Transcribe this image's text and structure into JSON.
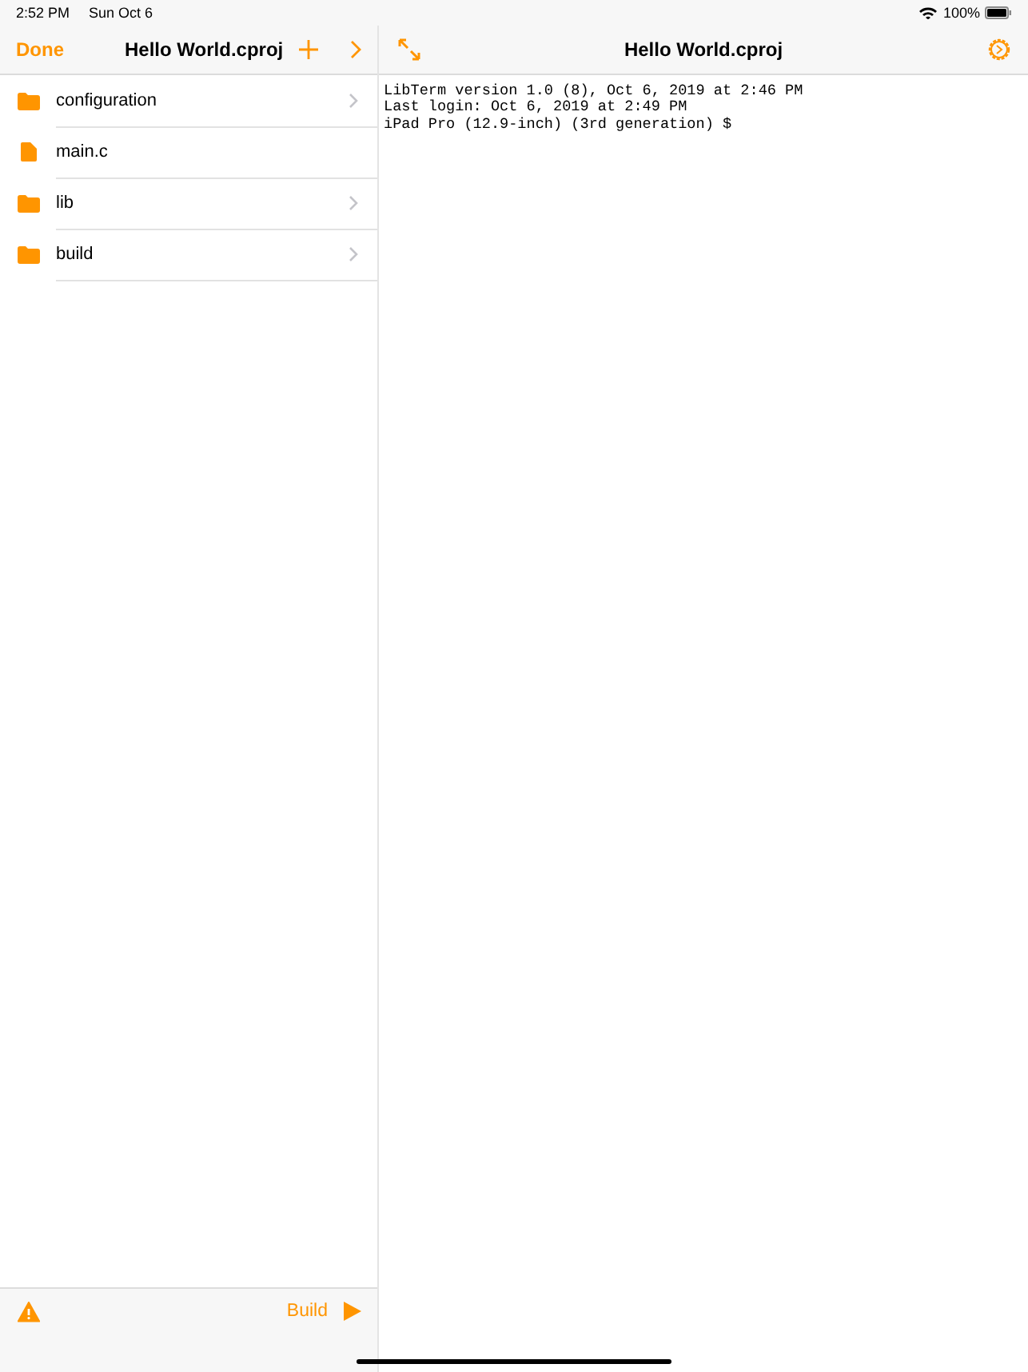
{
  "status_bar": {
    "time": "2:52 PM",
    "date": "Sun Oct 6",
    "battery": "100%"
  },
  "sidebar": {
    "done": "Done",
    "title": "Hello World.cproj",
    "items": [
      {
        "kind": "folder",
        "name": "configuration",
        "disclosure": true
      },
      {
        "kind": "file",
        "name": "main.c",
        "disclosure": false
      },
      {
        "kind": "folder",
        "name": "lib",
        "disclosure": true
      },
      {
        "kind": "folder",
        "name": "build",
        "disclosure": true
      }
    ],
    "footer": {
      "build": "Build"
    }
  },
  "terminal": {
    "title": "Hello World.cproj",
    "lines": [
      "LibTerm version 1.0 (8), Oct 6, 2019 at 2:46 PM",
      "Last login: Oct 6, 2019 at 2:49 PM",
      "iPad Pro (12.9-inch) (3rd generation) $"
    ]
  }
}
